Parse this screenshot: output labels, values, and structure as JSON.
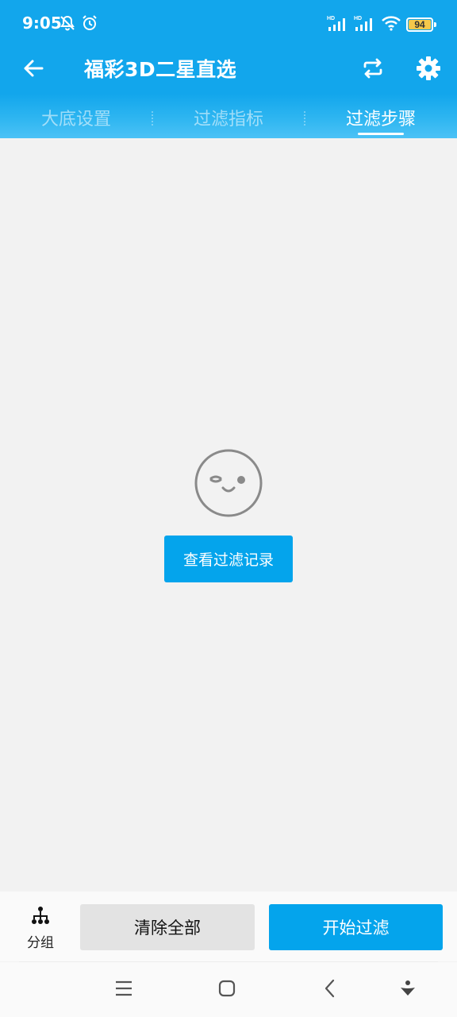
{
  "status_bar": {
    "time": "9:05",
    "battery": "94",
    "battery_color": "#f5c84b"
  },
  "toolbar": {
    "title": "福彩3D二星直选",
    "back_icon": "arrow-left-icon",
    "swap_icon": "swap-icon",
    "settings_icon": "gear-icon"
  },
  "tabs": [
    {
      "label": "大底设置",
      "active": false
    },
    {
      "label": "过滤指标",
      "active": false
    },
    {
      "label": "过滤步骤",
      "active": true
    }
  ],
  "empty_state": {
    "icon": "wink-face-icon",
    "button_label": "查看过滤记录"
  },
  "bottom_bar": {
    "group_label": "分组",
    "group_icon": "hierarchy-icon",
    "clear_label": "清除全部",
    "start_label": "开始过滤"
  },
  "nav_bar": {
    "menu_icon": "menu-icon",
    "home_icon": "home-icon",
    "back_icon": "chevron-left-icon",
    "assist_icon": "assistant-icon"
  },
  "colors": {
    "primary": "#12a6ec",
    "button_primary": "#04a4ec",
    "button_secondary": "#e3e3e3",
    "background": "#f2f2f2"
  }
}
